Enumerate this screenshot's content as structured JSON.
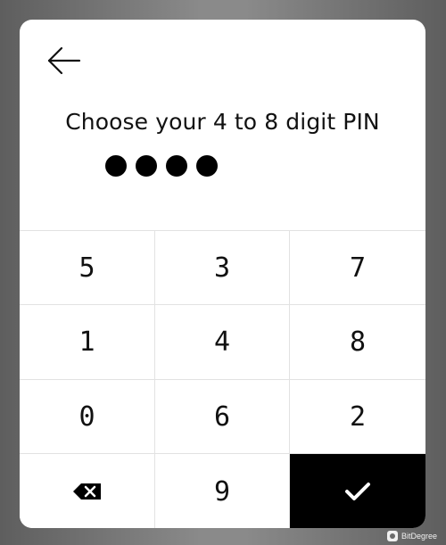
{
  "header": {
    "back_icon": "arrow-left-icon",
    "title": "Choose your 4 to 8 digit PIN"
  },
  "pin": {
    "entered_count": 4,
    "dot_color": "#000000"
  },
  "keypad": {
    "rows": [
      [
        "5",
        "3",
        "7"
      ],
      [
        "1",
        "4",
        "8"
      ],
      [
        "0",
        "6",
        "2"
      ]
    ],
    "bottom": {
      "backspace_icon": "backspace-icon",
      "digit": "9",
      "confirm_icon": "checkmark-icon",
      "confirm_color": "#000000"
    }
  },
  "watermark": {
    "text": "BitDegree"
  }
}
